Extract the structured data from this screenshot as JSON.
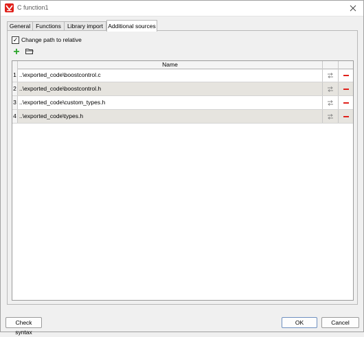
{
  "window": {
    "title": "C function1"
  },
  "tabs": [
    {
      "label": "General"
    },
    {
      "label": "Functions"
    },
    {
      "label": "Library import"
    },
    {
      "label": "Additional sources",
      "active": true
    }
  ],
  "options": {
    "change_path_label": "Change path to relative",
    "change_path_checked": true
  },
  "toolbar": {
    "add_icon": "plus-icon",
    "folder_icon": "folder-icon"
  },
  "table": {
    "header": "Name",
    "rows": [
      {
        "num": "1",
        "path": "..\\exported_code\\boostcontrol.c"
      },
      {
        "num": "2",
        "path": "..\\exported_code\\boostcontrol.h"
      },
      {
        "num": "3",
        "path": "..\\exported_code\\custom_types.h"
      },
      {
        "num": "4",
        "path": "..\\exported_code\\types.h"
      }
    ]
  },
  "footer": {
    "check_syntax": "Check syntax",
    "ok": "OK",
    "cancel": "Cancel"
  },
  "colors": {
    "accent_red": "#e0201a",
    "add_green": "#2aa52a",
    "row_alt": "#e6e4df"
  }
}
